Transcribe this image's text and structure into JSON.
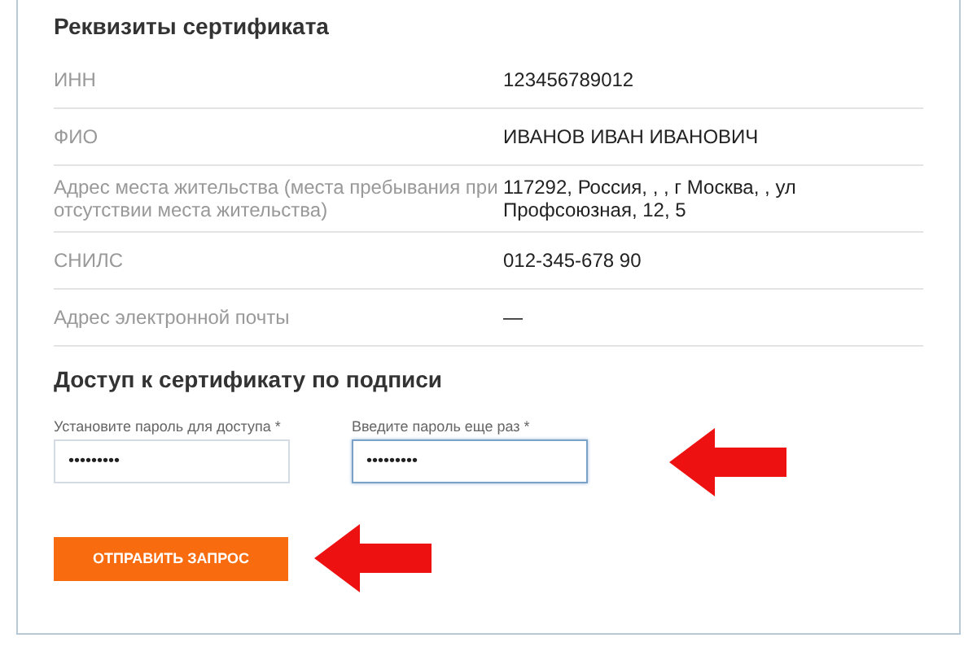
{
  "details": {
    "title": "Реквизиты сертификата",
    "rows": [
      {
        "label": "ИНН",
        "value": "123456789012"
      },
      {
        "label": "ФИО",
        "value": "ИВАНОВ ИВАН ИВАНОВИЧ"
      },
      {
        "label": "Адрес места жительства (места пребывания при отсутствии места жительства)",
        "value": "117292, Россия, , , г Москва, , ул Профсоюзная, 12, 5"
      },
      {
        "label": "СНИЛС",
        "value": "012-345-678 90"
      },
      {
        "label": "Адрес электронной почты",
        "value": "—"
      }
    ]
  },
  "access": {
    "title": "Доступ к сертификату по подписи",
    "fields": [
      {
        "label": "Установите пароль для доступа *",
        "value": "•••••••••",
        "focused": false
      },
      {
        "label": "Введите пароль еще раз *",
        "value": "•••••••••",
        "focused": true
      }
    ],
    "submit": "ОТПРАВИТЬ ЗАПРОС"
  }
}
